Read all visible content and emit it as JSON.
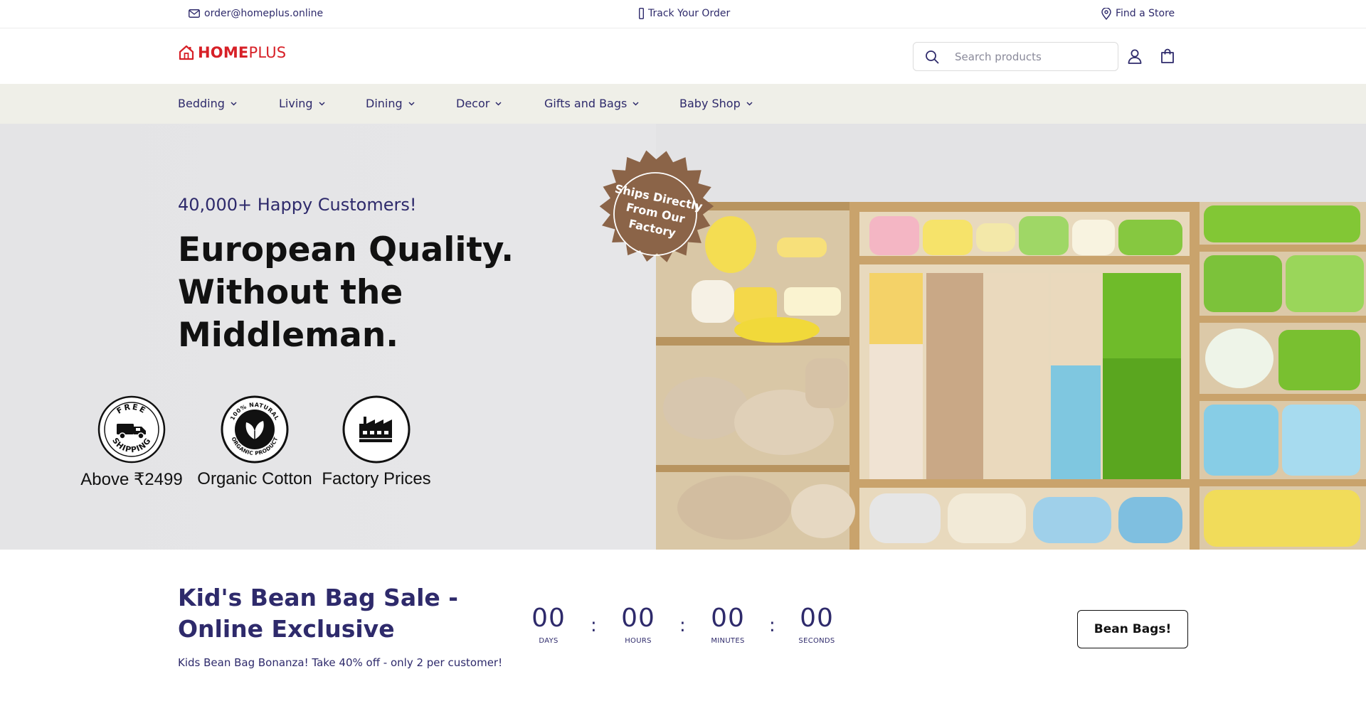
{
  "topbar": {
    "email": "order@homeplus.online",
    "track": "Track Your Order",
    "store": "Find a Store"
  },
  "header": {
    "logo_part1": "HOME",
    "logo_part2": "PLUS",
    "search_placeholder": "Search products"
  },
  "nav": {
    "items": [
      {
        "label": "Bedding"
      },
      {
        "label": "Living"
      },
      {
        "label": "Dining"
      },
      {
        "label": "Decor"
      },
      {
        "label": "Gifts and Bags"
      },
      {
        "label": "Baby Shop"
      }
    ]
  },
  "hero": {
    "kicker": "40,000+ Happy Customers!",
    "headline_line1": "European Quality.",
    "headline_line2": "Without the Middleman.",
    "stamp_line1": "Ships Directly",
    "stamp_line2": "From Our",
    "stamp_line3": "Factory",
    "features": [
      {
        "icon": "free-shipping-icon",
        "badge_top": "FREE",
        "badge_bottom": "SHIPPING",
        "caption": "Above ₹2499"
      },
      {
        "icon": "organic-product-icon",
        "badge_top": "100% NATURAL",
        "badge_bottom": "ORGANIC PRODUCT",
        "caption": "Organic Cotton"
      },
      {
        "icon": "factory-icon",
        "caption": "Factory Prices"
      }
    ]
  },
  "sale": {
    "title": "Kid's Bean Bag Sale - Online Exclusive",
    "description": "Kids Bean Bag Bonanza! Take 40% off - only 2 per customer!",
    "countdown": [
      {
        "value": "00",
        "label": "DAYS"
      },
      {
        "value": "00",
        "label": "HOURS"
      },
      {
        "value": "00",
        "label": "MINUTES"
      },
      {
        "value": "00",
        "label": "SECONDS"
      }
    ],
    "separator": ":",
    "cta": "Bean Bags!"
  },
  "colors": {
    "brand_red": "#d72027",
    "navy": "#2e2a6b",
    "nav_bg": "#efefe8",
    "stamp_brown": "#8b6448"
  }
}
